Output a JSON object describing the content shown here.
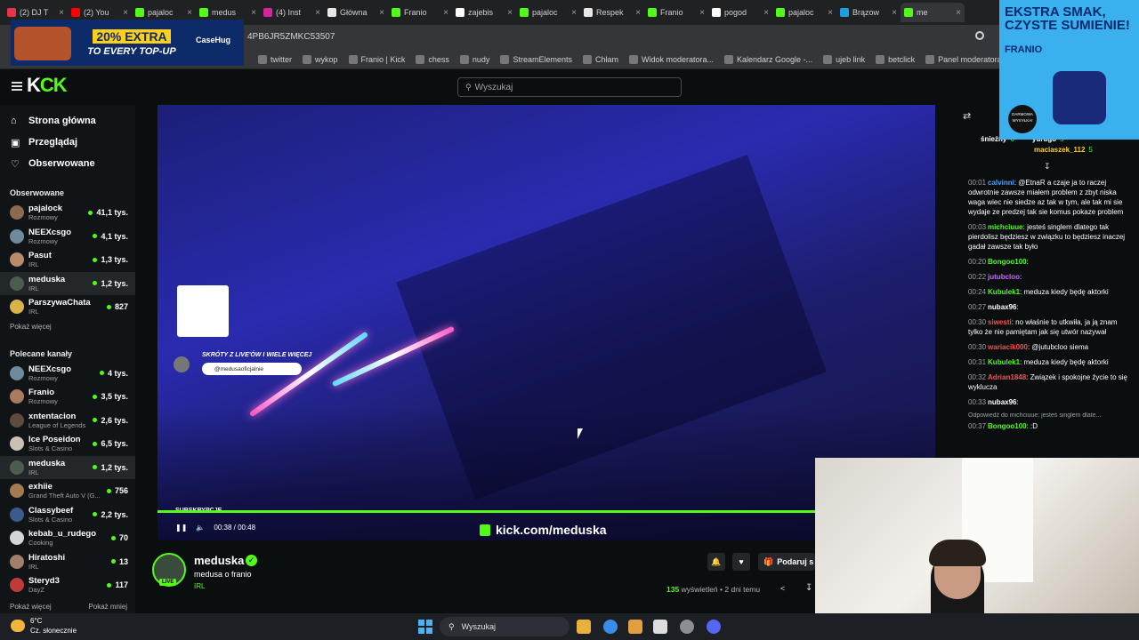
{
  "browser": {
    "tabs": [
      {
        "label": "(2) DJ T",
        "color": "#e8334a"
      },
      {
        "label": "(2) You",
        "color": "#ff0000"
      },
      {
        "label": "pajaloc",
        "color": "#53fc18"
      },
      {
        "label": "medus",
        "color": "#53fc18"
      },
      {
        "label": "(4) Inst",
        "color": "#d6249f"
      },
      {
        "label": "Główna",
        "color": "#e7e7e7"
      },
      {
        "label": "Franio",
        "color": "#53fc18"
      },
      {
        "label": "zajebis",
        "color": "#ffffff"
      },
      {
        "label": "pajaloc",
        "color": "#53fc18"
      },
      {
        "label": "Respek",
        "color": "#e7e7e7"
      },
      {
        "label": "Franio",
        "color": "#53fc18"
      },
      {
        "label": "pogod",
        "color": "#ffffff"
      },
      {
        "label": "pajaloc",
        "color": "#53fc18"
      },
      {
        "label": "Brązow",
        "color": "#1ba0e2"
      },
      {
        "label": "me",
        "color": "#53fc18"
      }
    ],
    "url": "4PB6JR5ZMKC53507",
    "bookmarks": [
      {
        "label": "twitter",
        "icon": "x-icon"
      },
      {
        "label": "wykop",
        "icon": "wykop-icon"
      },
      {
        "label": "Franio | Kick",
        "icon": "kick-icon"
      },
      {
        "label": "chess",
        "icon": "chess-icon"
      },
      {
        "label": "nudy",
        "icon": "folder-icon"
      },
      {
        "label": "StreamElements",
        "icon": "streamelements-icon"
      },
      {
        "label": "Chłam",
        "icon": "globe-icon"
      },
      {
        "label": "Widok moderatora...",
        "icon": "twitch-icon"
      },
      {
        "label": "Kalendarz Google -...",
        "icon": "calendar-icon"
      },
      {
        "label": "ujeb link",
        "icon": "globe-icon"
      },
      {
        "label": "betclick",
        "icon": "betclick-icon"
      },
      {
        "label": "Panel moderatora |...",
        "icon": "kick-icon"
      }
    ]
  },
  "ad_topleft": {
    "promo_line1": "20% EXTRA",
    "promo_line2": "TO EVERY TOP-UP",
    "brand": "CaseHug"
  },
  "ad_right": {
    "headline": "EKSTRA SMAK, CZYSTE SUMIENIE!",
    "brand": "FRANIO",
    "badge": "DARMOWA WYSYŁKA!"
  },
  "kick": {
    "logo_left": "K",
    "logo_right": "CK",
    "search_placeholder": "Wyszukaj",
    "nav": [
      {
        "label": "Strona główna",
        "icon": "home-icon"
      },
      {
        "label": "Przeglądaj",
        "icon": "browse-icon"
      },
      {
        "label": "Obserwowane",
        "icon": "heart-icon"
      }
    ],
    "followed_title": "Obserwowane",
    "followed": [
      {
        "name": "pajalock",
        "category": "Rozmowy",
        "viewers": "41,1 tys.",
        "color": "#8b6a4f"
      },
      {
        "name": "NEEXcsgo",
        "category": "Rozmowy",
        "viewers": "4,1 tys.",
        "color": "#6f8a9c"
      },
      {
        "name": "Pasut",
        "category": "IRL",
        "viewers": "1,3 tys.",
        "color": "#b88b6b"
      },
      {
        "name": "meduska",
        "category": "IRL",
        "viewers": "1,2 tys.",
        "color": "#4c5c4f"
      },
      {
        "name": "ParszywaChata",
        "category": "IRL",
        "viewers": "827",
        "color": "#d9b24a"
      }
    ],
    "show_more": "Pokaż więcej",
    "recommended_title": "Polecane kanały",
    "recommended": [
      {
        "name": "NEEXcsgo",
        "category": "Rozmowy",
        "viewers": "4 tys.",
        "color": "#6f8a9c"
      },
      {
        "name": "Franio",
        "category": "Rozmowy",
        "viewers": "3,5 tys.",
        "color": "#a87a5e"
      },
      {
        "name": "xntentacion",
        "category": "League of Legends",
        "viewers": "2,6 tys.",
        "color": "#5b4a3d"
      },
      {
        "name": "Ice Poseidon",
        "category": "Slots & Casino",
        "viewers": "6,5 tys.",
        "color": "#c9c2b4"
      },
      {
        "name": "meduska",
        "category": "IRL",
        "viewers": "1,2 tys.",
        "color": "#4c5c4f"
      },
      {
        "name": "exhiie",
        "category": "Grand Theft Auto V (G...",
        "viewers": "756",
        "color": "#a37a52"
      },
      {
        "name": "Classybeef",
        "category": "Slots & Casino",
        "viewers": "2,2 tys.",
        "color": "#3b5b8a"
      },
      {
        "name": "kebab_u_rudego",
        "category": "Cooking",
        "viewers": "70",
        "color": "#d6d6d6"
      },
      {
        "name": "Hiratoshi",
        "category": "IRL",
        "viewers": "13",
        "color": "#a07e6a"
      },
      {
        "name": "Steryd3",
        "category": "DayZ",
        "viewers": "117",
        "color": "#c03a3a"
      }
    ],
    "show_more_2": "Pokaż więcej",
    "show_less": "Pokaż mniej"
  },
  "player": {
    "qr_caption": "SKRÓTY Z LIVE'ÓW I WIELE WIĘCEJ",
    "qr_handle": "@medusaoficjalnie",
    "sub_label": "SUBSKRYPCJE",
    "time": "00:38 / 00:48",
    "progress": 0.845,
    "watermark": "kick.com/meduska"
  },
  "channel": {
    "name": "meduska",
    "title": "medusa o franio",
    "category": "IRL",
    "live": "LIVE",
    "views_count": "135",
    "views_label": "wyświetleń",
    "age": "• 2 dni temu",
    "gift_label": "Podaruj s"
  },
  "chat": {
    "gifters": [
      {
        "name": "śnieżny",
        "count": "6"
      },
      {
        "name": "yurugo",
        "count": "5"
      },
      {
        "name": "maciaszek_112",
        "count": "5"
      }
    ],
    "messages": [
      {
        "time": "00:01",
        "user": "calvinni",
        "color": "#4aa3ff",
        "text": "@EtnaR a czaje ja to raczej odwrotnie zawsze miałem problem z zbyt niska waga wiec nie siedze az tak w tym, ale tak mi sie wydaje ze predzej tak sie komus pokaze problem"
      },
      {
        "time": "00:03",
        "user": "michciuue",
        "color": "#53fc18",
        "text": "jesteś singlem dlatego tak pierdolisz będziesz w związku to będziesz inaczej gadał zawsze tak było"
      },
      {
        "time": "00:20",
        "user": "Bongoo100",
        "color": "#53fc18",
        "text": ""
      },
      {
        "time": "00:22",
        "user": "jutubcloo",
        "color": "#c46bff",
        "text": ""
      },
      {
        "time": "00:24",
        "user": "Kubulek1",
        "color": "#53fc18",
        "text": "meduza kiedy będę aktorki"
      },
      {
        "time": "00:27",
        "user": "nubax96",
        "color": "#ffffff",
        "text": ""
      },
      {
        "time": "00:30",
        "user": "siwesti",
        "color": "#ff4d4d",
        "text": "no właśnie to utkwiła, ja ją znam tylko że nie pamiętam jak się utwór nazywał"
      },
      {
        "time": "00:30",
        "user": "wariacik000",
        "color": "#ff4d4d",
        "text": "@jutubcloo siema"
      },
      {
        "time": "00:31",
        "user": "Kubulek1",
        "color": "#53fc18",
        "text": "meduza kiedy będę aktorki"
      },
      {
        "time": "00:32",
        "user": "Adrian1848",
        "color": "#ff4d4d",
        "text": "Związek i spokojne życie to się wyklucza"
      },
      {
        "time": "00:33",
        "user": "nubax96",
        "color": "#ffffff",
        "text": ""
      }
    ],
    "reply_note": "Odpowiedź do michciuue: jesteś singlem dlate...",
    "last": {
      "time": "00:37",
      "user": "Bongoo100",
      "color": "#53fc18",
      "text": ":D"
    }
  },
  "taskbar": {
    "temp": "6°C",
    "weather": "Cz. słonecznie",
    "search": "Wyszukaj"
  }
}
